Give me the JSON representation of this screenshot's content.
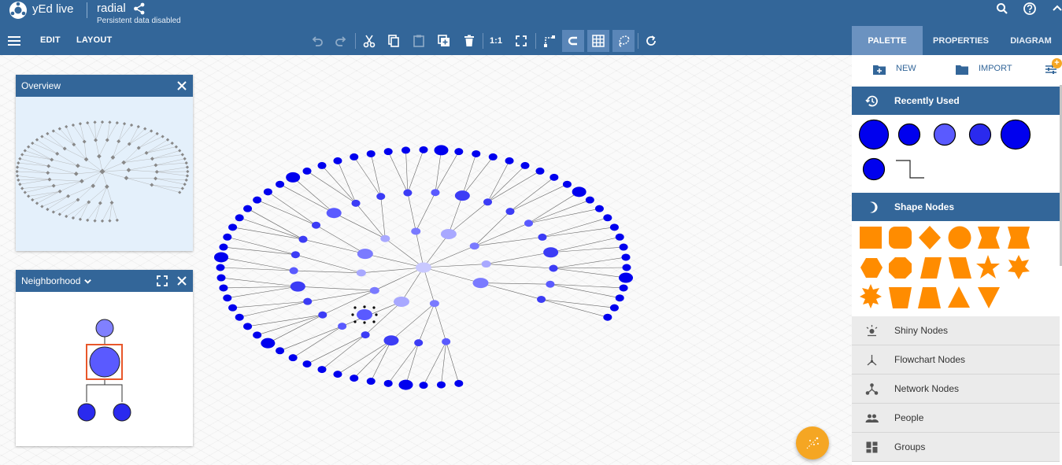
{
  "app": {
    "name": "yEd live",
    "document": "radial",
    "status": "Persistent data disabled"
  },
  "menu": {
    "edit": "EDIT",
    "layout": "LAYOUT"
  },
  "toolbar": {
    "ratio_label": "1:1"
  },
  "tabs": {
    "palette": "PALETTE",
    "properties": "PROPERTIES",
    "diagram": "DIAGRAM"
  },
  "panels": {
    "overview": "Overview",
    "neighborhood": "Neighborhood"
  },
  "sidebar": {
    "new": "NEW",
    "import": "IMPORT",
    "sections": {
      "recent": "Recently Used",
      "shape": "Shape Nodes",
      "shiny": "Shiny Nodes",
      "flowchart": "Flowchart Nodes",
      "network": "Network Nodes",
      "people": "People",
      "groups": "Groups"
    }
  },
  "colors": {
    "header": "#336699",
    "node_dark": "#0000ee",
    "node_mid": "#5a5aff",
    "node_light": "#a8a8ff",
    "shape_orange": "#ff8c00",
    "fab": "#f5a623",
    "selection": "#e8572a"
  },
  "icons": {
    "logo": "yed-logo-icon",
    "share": "share-icon",
    "search": "search-icon",
    "help": "help-icon",
    "collapse": "chevron-up-icon",
    "menu": "hamburger-menu-icon",
    "undo": "undo-icon",
    "redo": "redo-icon",
    "cut": "cut-icon",
    "copy": "copy-icon",
    "paste": "paste-icon",
    "duplicate": "duplicate-icon",
    "delete": "delete-icon",
    "fit": "fit-content-icon",
    "orthogonal": "orthogonal-edges-icon",
    "snapping": "snapping-icon",
    "grid": "grid-icon",
    "lasso": "lasso-icon",
    "layout": "refresh-layout-icon"
  }
}
